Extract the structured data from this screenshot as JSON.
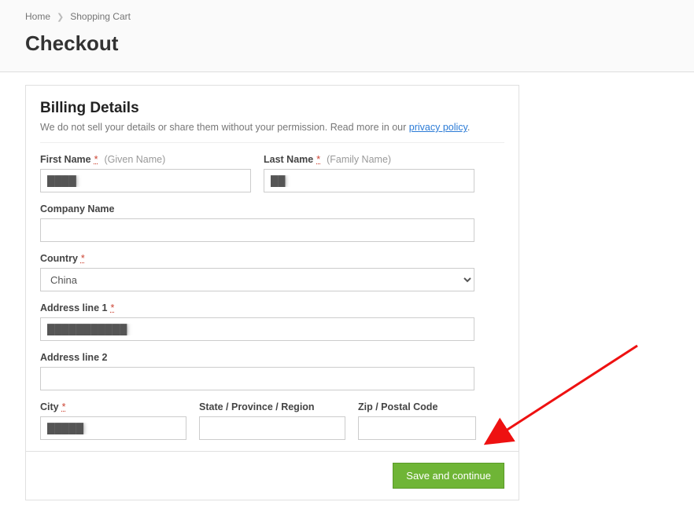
{
  "breadcrumb": {
    "home": "Home",
    "cart": "Shopping Cart"
  },
  "page_title": "Checkout",
  "card": {
    "title": "Billing Details",
    "subtitle_prefix": "We do not sell your details or share them without your permission. Read more in our ",
    "privacy_link": "privacy policy",
    "subtitle_suffix": "."
  },
  "labels": {
    "first_name": "First Name",
    "first_name_hint": "(Given Name)",
    "last_name": "Last Name",
    "last_name_hint": "(Family Name)",
    "company": "Company Name",
    "country": "Country",
    "address1": "Address line 1",
    "address2": "Address line 2",
    "city": "City",
    "state": "State / Province / Region",
    "zip": "Zip / Postal Code",
    "required_marker": "*"
  },
  "values": {
    "first_name": "████",
    "last_name": "██",
    "company": "",
    "country": "China",
    "address1": "███████████",
    "address2": "",
    "city": "█████",
    "state": "",
    "zip": ""
  },
  "buttons": {
    "save": "Save and continue"
  }
}
